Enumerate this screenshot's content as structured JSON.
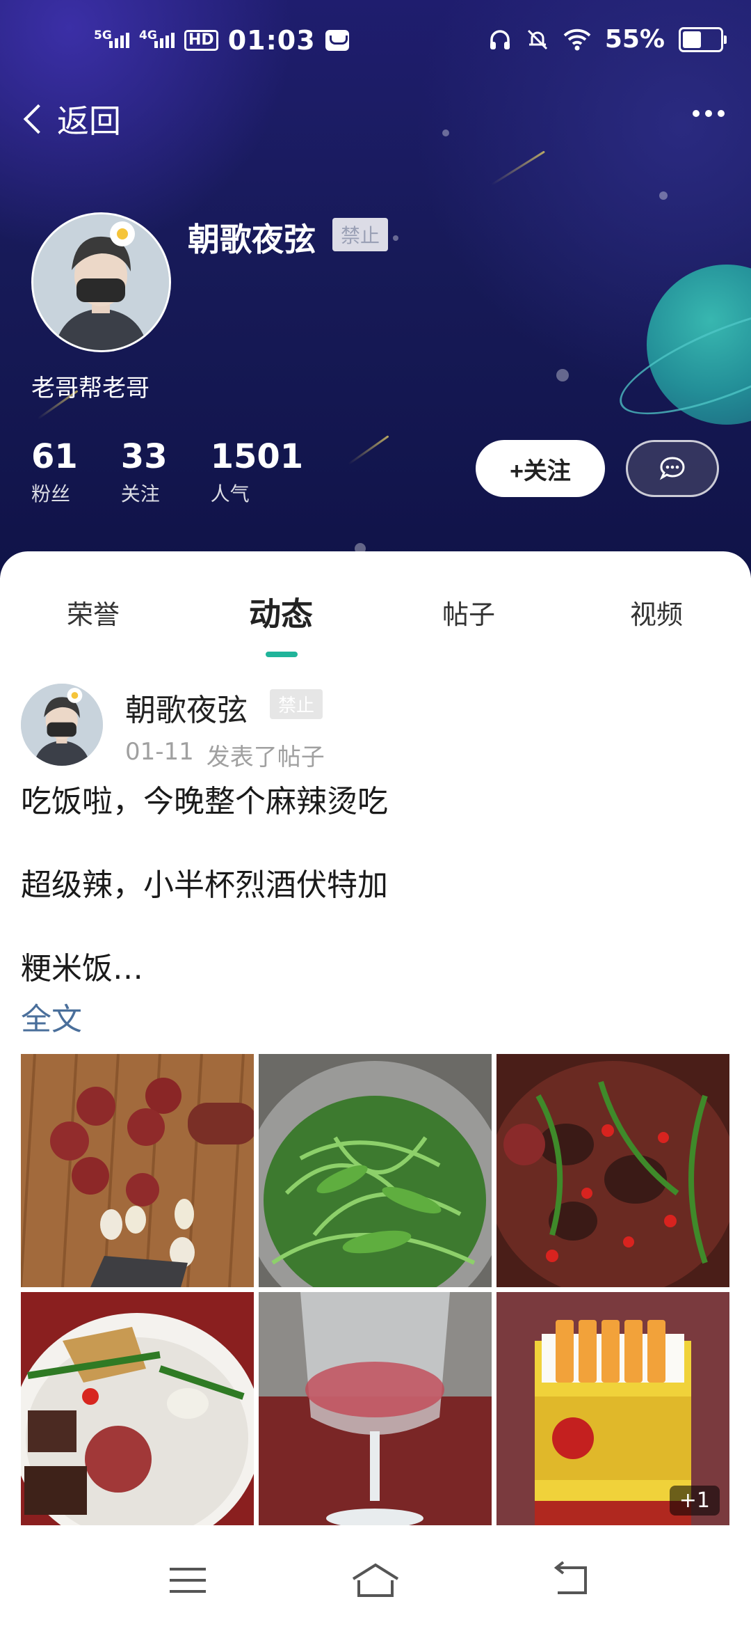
{
  "status_bar": {
    "network_1": "5G",
    "network_2": "4G",
    "hd_label": "HD",
    "time": "01:03",
    "battery_percent": "55%",
    "battery_level": 0.55,
    "icons": [
      "headphones-icon",
      "mute-bell-icon",
      "wifi-icon",
      "battery-icon"
    ]
  },
  "header": {
    "back_label": "返回",
    "more_icon": "more-dots-icon"
  },
  "profile": {
    "name": "朝歌夜弦",
    "badge": "禁止",
    "bio": "老哥帮老哥",
    "stats": [
      {
        "value": "61",
        "label": "粉丝"
      },
      {
        "value": "33",
        "label": "关注"
      },
      {
        "value": "1501",
        "label": "人气"
      }
    ],
    "follow_button": "+关注",
    "message_icon": "chat-bubble-icon"
  },
  "tabs": [
    {
      "label": "荣誉",
      "active": false
    },
    {
      "label": "动态",
      "active": true
    },
    {
      "label": "帖子",
      "active": false
    },
    {
      "label": "视频",
      "active": false
    }
  ],
  "post": {
    "author": "朝歌夜弦",
    "badge": "禁止",
    "date": "01-11",
    "action": "发表了帖子",
    "lines": [
      "吃饭啦，今晚整个麻辣烫吃",
      "超级辣，小半杯烈酒伏特加",
      "粳米饭…"
    ],
    "full_text_link": "全文",
    "images": [
      {
        "desc": "sausage-slices-garlic"
      },
      {
        "desc": "green-vegetables-pot"
      },
      {
        "desc": "spicy-hotpot-dish"
      },
      {
        "desc": "rice-plate-meal"
      },
      {
        "desc": "wine-glass"
      },
      {
        "desc": "cigarette-pack"
      }
    ],
    "more_images_badge": "+1"
  },
  "colors": {
    "accent": "#20b49a",
    "link": "#4a6f9b",
    "hero_bg": "#171a58"
  },
  "bottom_nav": [
    "menu-icon",
    "home-icon",
    "back-icon"
  ]
}
